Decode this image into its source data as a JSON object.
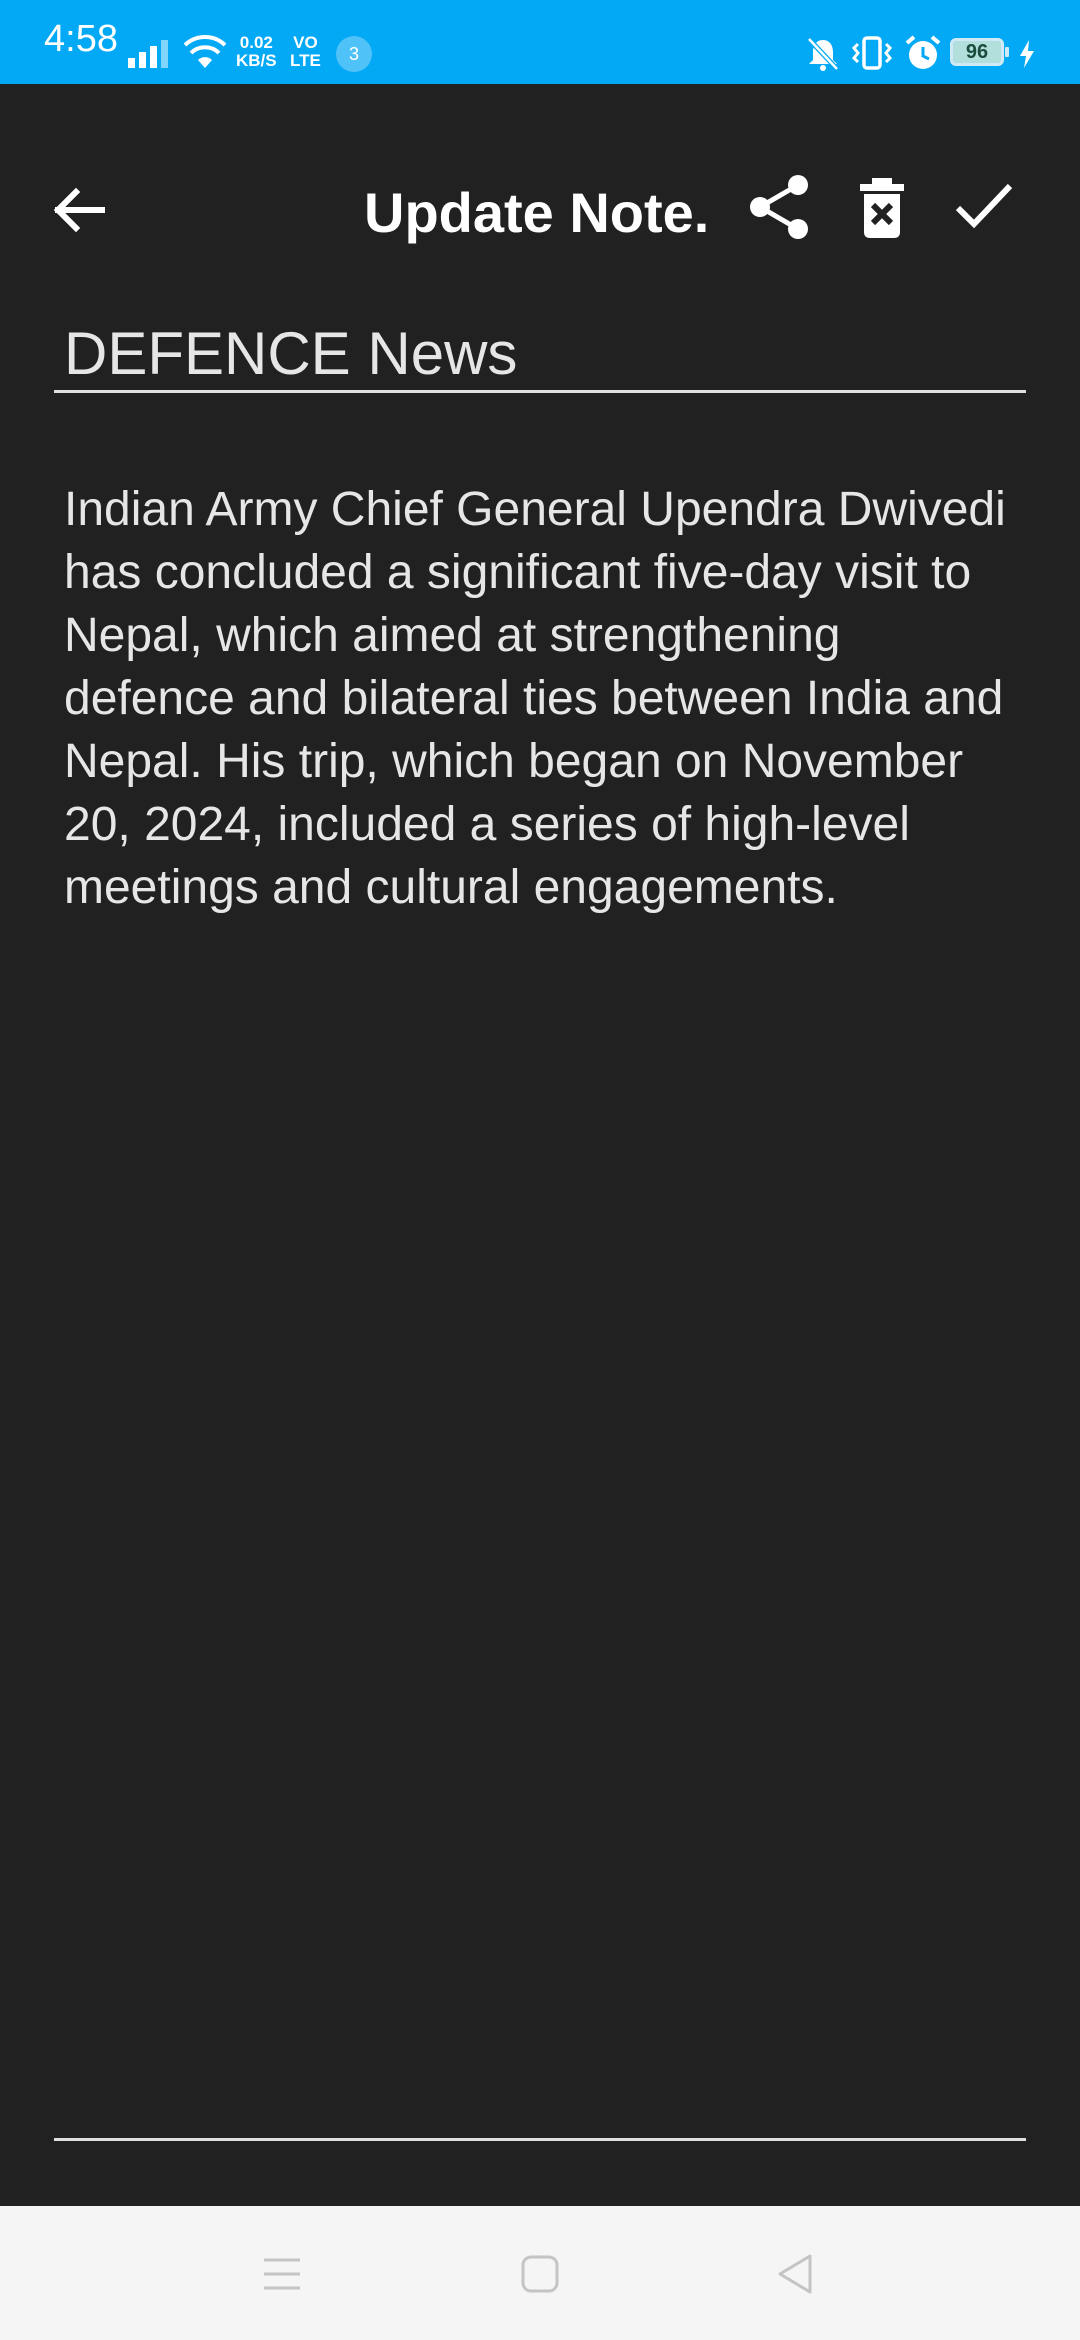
{
  "status_bar": {
    "time": "4:58",
    "net_speed_value": "0.02",
    "net_speed_unit": "KB/S",
    "volte_top": "VO",
    "volte_bottom": "LTE",
    "notification_count": "3",
    "battery_level": "96",
    "color": "#03a9f4"
  },
  "app_bar": {
    "title": "Update Note.",
    "icons": [
      "back-arrow-icon",
      "share-icon",
      "delete-icon",
      "checkmark-icon"
    ]
  },
  "note": {
    "title": "DEFENCE News",
    "body": "Indian Army Chief General Upendra Dwivedi has concluded a significant five-day visit to Nepal, which aimed at strengthening defence and bilateral ties between India and Nepal. His trip, which began on November 20, 2024, included a series of high-level meetings and cultural engagements."
  },
  "nav_bar": {
    "icons": [
      "menu-icon",
      "home-icon",
      "back-icon"
    ]
  },
  "colors": {
    "background": "#212121",
    "text": "#e6e6e6",
    "divider": "#e0e0e0"
  }
}
